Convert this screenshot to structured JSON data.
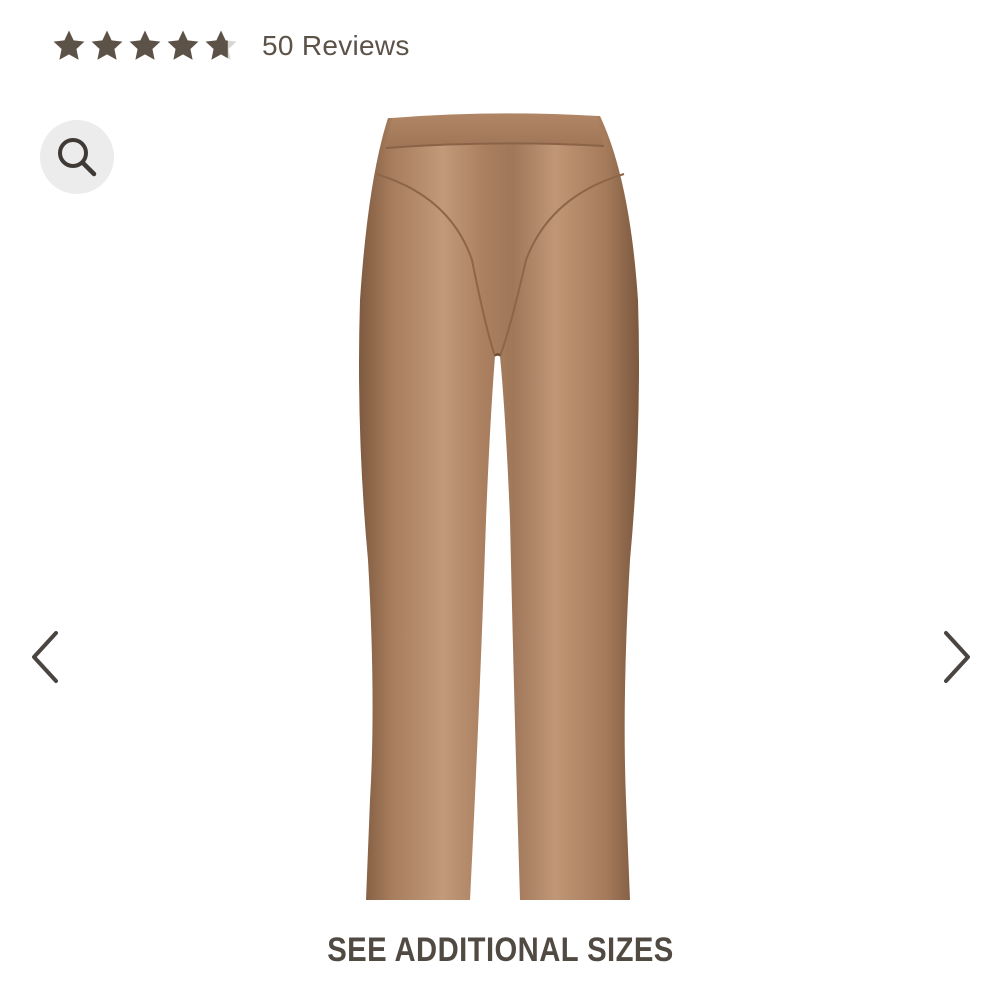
{
  "rating": {
    "value": 4.7,
    "max": 5,
    "reviews_label": "50 Reviews",
    "star_color": "#5c5248",
    "star_empty_color": "#d9d5d0"
  },
  "gallery": {
    "zoom_icon": "search-icon",
    "prev_icon": "chevron-left-icon",
    "next_icon": "chevron-right-icon",
    "product_color": "#a57b5b",
    "product_image": "brown-shiny-flared-leggings"
  },
  "sizes": {
    "label": "SEE ADDITIONAL SIZES"
  }
}
